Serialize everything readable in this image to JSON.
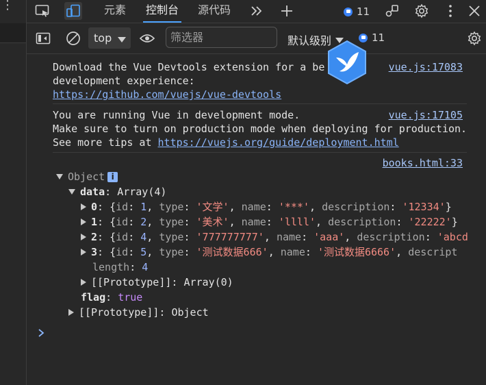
{
  "tabs": [
    {
      "label": "元素"
    },
    {
      "label": "控制台"
    },
    {
      "label": "源代码"
    }
  ],
  "issues_count": "11",
  "toolbar": {
    "context": "top",
    "filter_placeholder": "筛选器",
    "level_label": "默认级别",
    "issues_count": "11"
  },
  "messages": [
    {
      "lines": [
        "Download the Vue Devtools extension for a be",
        "development experience:"
      ],
      "link": "https://github.com/vuejs/vue-devtools",
      "source": "vue.js:17083"
    },
    {
      "lines": [
        "You are running Vue in development mode.",
        "Make sure to turn on production mode when deploying for production."
      ],
      "tip_prefix": "See more tips at ",
      "link": "https://vuejs.org/guide/deployment.html",
      "source": "vue.js:17105"
    },
    {
      "source": "books.html:33"
    }
  ],
  "object_tree": {
    "root_label": "Object",
    "info_glyph": "i",
    "data_key": "data",
    "data_type": "Array(4)",
    "items": [
      {
        "index": "0",
        "text": "{id: 1, type: '文学', name: '***', description: '12334'}"
      },
      {
        "index": "1",
        "text": "{id: 2, type: '美术', name: 'llll', description: '22222'}"
      },
      {
        "index": "2",
        "text": "{id: 4, type: '777777777', name: 'aaa', description: 'abcd"
      },
      {
        "index": "3",
        "text": "{id: 5, type: '测试数据666', name: '测试数据6666', descript"
      }
    ],
    "length_key": "length",
    "length_value": "4",
    "array_proto": "[[Prototype]]: Array(0)",
    "flag_key": "flag",
    "flag_value": "true",
    "object_proto": "[[Prototype]]: Object"
  }
}
